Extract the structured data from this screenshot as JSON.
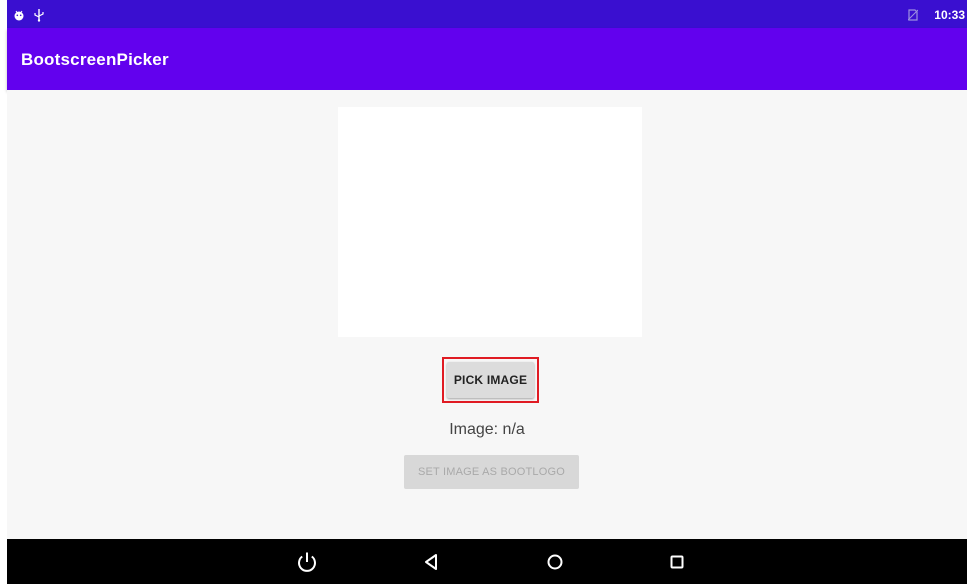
{
  "status_bar": {
    "time": "10:33",
    "left_icons": [
      "android-debug-icon",
      "usb-icon"
    ],
    "right_icons": [
      "no-sim-icon"
    ]
  },
  "app_bar": {
    "title": "BootscreenPicker",
    "color": "#6201ee"
  },
  "main": {
    "pick_button_label": "PICK IMAGE",
    "image_label": "Image: n/a",
    "set_button_label": "SET IMAGE AS BOOTLOGO",
    "highlight_color": "#e01b23"
  },
  "nav_bar": {
    "icons": [
      "power-icon",
      "back-icon",
      "home-icon",
      "recents-icon"
    ]
  }
}
